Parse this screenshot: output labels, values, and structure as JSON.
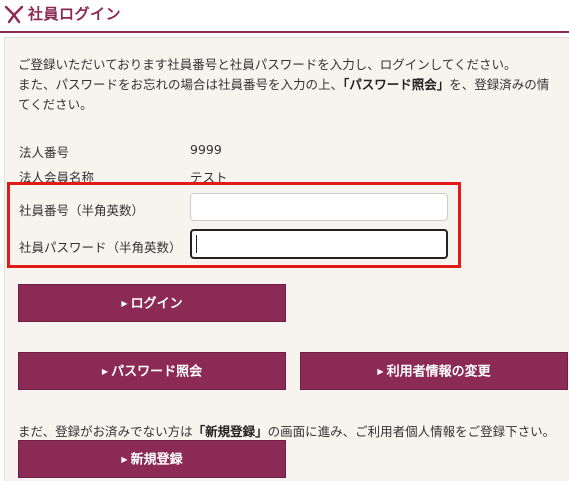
{
  "header": {
    "title": "社員ログイン"
  },
  "intro": {
    "line1": "ご登録いただいております社員番号と社員パスワードを入力し、ログインしてください。",
    "line2_before": "また、パスワードをお忘れの場合は社員番号を入力の上、",
    "line2_bold": "「パスワード照会」",
    "line2_after": "を、登録済みの情",
    "line3": "てください。"
  },
  "info": {
    "corp_number_label": "法人番号",
    "corp_number_value": "9999",
    "corp_name_label": "法人会員名称",
    "corp_name_value": "テスト"
  },
  "form": {
    "employee_number_label": "社員番号（半角英数）",
    "employee_number_value": "",
    "employee_password_label": "社員パスワード（半角英数）",
    "employee_password_value": ""
  },
  "buttons": {
    "login": "ログイン",
    "password_inquiry": "パスワード照会",
    "change_user_info": "利用者情報の変更",
    "new_registration": "新規登録"
  },
  "register_note": {
    "before": "まだ、登録がお済みでない方は",
    "bold": "「新規登録」",
    "after": "の画面に進み、ご利用者個人情報をご登録下さい。"
  },
  "colors": {
    "accent": "#8b2a55",
    "highlight": "#e21a1a"
  },
  "icons": {
    "logo": "ribbon-logo-icon",
    "button_arrow": "triangle-right-icon"
  }
}
